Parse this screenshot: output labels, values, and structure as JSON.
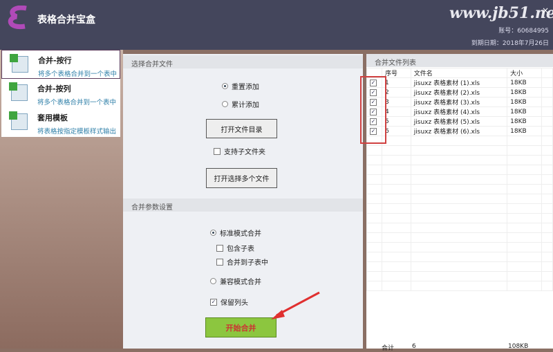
{
  "app": {
    "title": "表格合并宝盒",
    "watermark": "www.jb51.net",
    "account": "账号：60684995",
    "expiry": "到期日期：2018年7月26日",
    "close": "×"
  },
  "sidebar": {
    "items": [
      {
        "title": "合并-按行",
        "desc": "将多个表格合并到一个表中"
      },
      {
        "title": "合并-按列",
        "desc": "将多个表格合并到一个表中"
      },
      {
        "title": "套用模板",
        "desc": "将表格按指定模板样式输出"
      }
    ]
  },
  "select": {
    "header": "选择合并文件",
    "reset_add": "重置添加",
    "accum_add": "累计添加",
    "open_dir": "打开文件目录",
    "subfolder": "支持子文件夹",
    "open_multi": "打开选择多个文件"
  },
  "params": {
    "header": "合并参数设置",
    "standard": "标准模式合并",
    "include_sub": "包含子表",
    "merge_to_sub": "合并到子表中",
    "compat": "兼容模式合并",
    "keep_header": "保留列头",
    "start": "开始合并"
  },
  "list": {
    "header": "合并文件列表",
    "columns": [
      "序号",
      "文件名",
      "大小"
    ],
    "rows": [
      {
        "no": "1",
        "name": "jisuxz 表格素材 (1).xls",
        "size": "18KB"
      },
      {
        "no": "2",
        "name": "jisuxz 表格素材 (2).xls",
        "size": "18KB"
      },
      {
        "no": "3",
        "name": "jisuxz 表格素材 (3).xls",
        "size": "18KB"
      },
      {
        "no": "4",
        "name": "jisuxz 表格素材 (4).xls",
        "size": "18KB"
      },
      {
        "no": "5",
        "name": "jisuxz 表格素材 (5).xls",
        "size": "18KB"
      },
      {
        "no": "6",
        "name": "jisuxz 表格素材 (6).xls",
        "size": "18KB"
      }
    ],
    "footer": {
      "label": "合计",
      "count": "6",
      "size": "108KB"
    }
  }
}
